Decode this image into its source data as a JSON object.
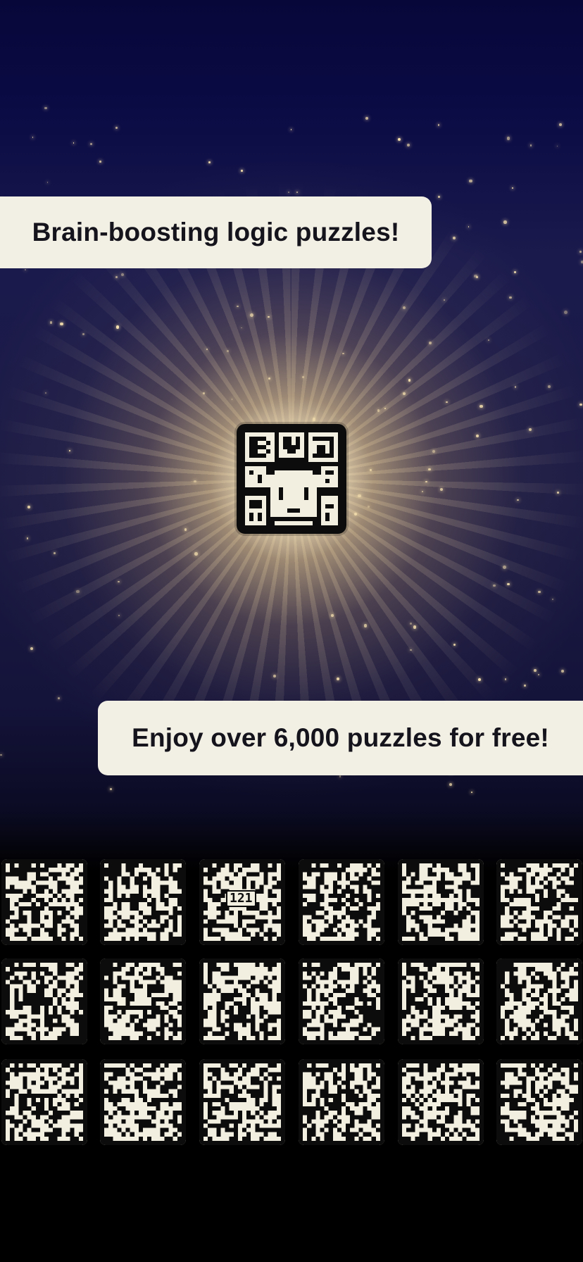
{
  "banners": {
    "top": "Brain-boosting logic puzzles!",
    "bottom": "Enjoy over 6,000 puzzles for free!"
  },
  "colors": {
    "background_top": "#07073a",
    "background_bottom": "#000000",
    "glow": "#fff0c8",
    "banner": "#f2efe4",
    "banner_text": "#15131c",
    "tile_paper": "#f2eee0",
    "tile_ink": "#0c0c0c"
  },
  "featured_puzzle": {
    "icon": "pixel-art-collage-icon"
  },
  "puzzle_tiles": [
    {
      "icon": "chef-icon"
    },
    {
      "icon": "knight-icon"
    },
    {
      "icon": "train-icon",
      "label": "121"
    },
    {
      "icon": "hooded-figures-icon"
    },
    {
      "icon": "shopper-with-cart-icon"
    },
    {
      "icon": "witch-icon"
    },
    {
      "icon": "creature-icon"
    },
    {
      "icon": "ship-icon"
    },
    {
      "icon": "bear-icon"
    },
    {
      "icon": "piano-icon"
    },
    {
      "icon": "treasure-chest-icon"
    },
    {
      "icon": "dragon-icon"
    },
    {
      "icon": "cat-icon"
    },
    {
      "icon": "noodle-bowl-icon"
    },
    {
      "icon": "ornament-icon"
    },
    {
      "icon": "camera-icon"
    },
    {
      "icon": "fish-icon"
    },
    {
      "icon": "warrior-icon"
    }
  ]
}
